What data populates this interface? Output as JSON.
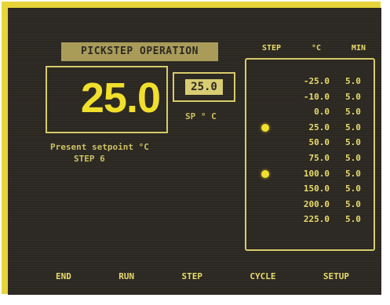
{
  "screen": {
    "title": "PICKSTEP OPERATION",
    "main_value": "25.0",
    "secondary_value": "25.0",
    "secondary_caption": "SP ° C",
    "left_caption_line1": "Present setpoint °C",
    "left_caption_line2": "STEP 6",
    "table_headers": [
      "STEP",
      "°C",
      "MIN"
    ],
    "table_rows": [
      {
        "value": "-25.0",
        "status": "5.0",
        "selected": false
      },
      {
        "value": "-10.0",
        "status": "5.0",
        "selected": false
      },
      {
        "value": "0.0",
        "status": "5.0",
        "selected": false
      },
      {
        "value": "25.0",
        "status": "5.0",
        "selected": true
      },
      {
        "value": "50.0",
        "status": "5.0",
        "selected": false
      },
      {
        "value": "75.0",
        "status": "5.0",
        "selected": false
      },
      {
        "value": "100.0",
        "status": "5.0",
        "selected": true
      },
      {
        "value": "150.0",
        "status": "5.0",
        "selected": false
      },
      {
        "value": "200.0",
        "status": "5.0",
        "selected": false
      },
      {
        "value": "225.0",
        "status": "5.0",
        "selected": false
      }
    ],
    "softkeys": [
      "END",
      "RUN",
      "STEP",
      "CYCLE",
      "SETUP"
    ]
  },
  "colors": {
    "frame": "#e6d43a",
    "screen_background": "#2b2721",
    "text": "#e8db6a",
    "highlight": "#f1df2a"
  },
  "icons": {
    "selected_marker": "yellow-dot-icon"
  }
}
